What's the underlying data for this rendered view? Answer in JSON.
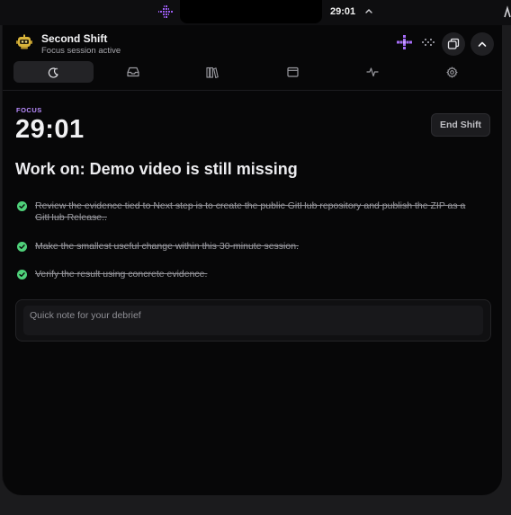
{
  "menubar": {
    "clock": "29:01",
    "app_glyph_icon": "pixel-plus-icon",
    "chevron_icon": "chevron-up-icon"
  },
  "app": {
    "title": "Second Shift",
    "status": "Focus session active",
    "logo_icon": "robot-mascot-icon",
    "accent_color": "#b98cff"
  },
  "header_actions": {
    "sparkle_icon": "sparkle-dots-icon",
    "window_icon": "overlapping-windows-icon",
    "collapse_icon": "chevron-up-icon"
  },
  "tabs": [
    {
      "icon": "moon-sparkle-icon",
      "active": true
    },
    {
      "icon": "inbox-icon",
      "active": false
    },
    {
      "icon": "library-icon",
      "active": false
    },
    {
      "icon": "calendar-icon",
      "active": false
    },
    {
      "icon": "activity-pulse-icon",
      "active": false
    },
    {
      "icon": "gear-icon",
      "active": false
    }
  ],
  "session": {
    "label": "FOCUS",
    "timer": "29:01",
    "end_button": "End Shift",
    "work_on": "Work on: Demo video is still missing"
  },
  "tasks": [
    {
      "text": "Review the evidence tied to Next step is to create the public GitHub repository and publish the ZIP as a GitHub Release..",
      "done": true
    },
    {
      "text": "Make the smallest useful change within this 30-minute session.",
      "done": true
    },
    {
      "text": "Verify the result using concrete evidence.",
      "done": true
    }
  ],
  "note": {
    "placeholder": "Quick note for your debrief",
    "value": ""
  },
  "colors": {
    "check_green": "#4fd17a",
    "panel_bg": "#070708"
  }
}
